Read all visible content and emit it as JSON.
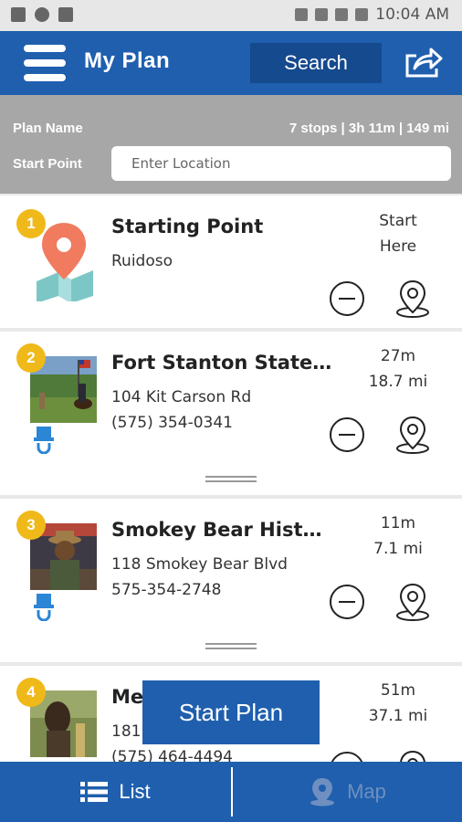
{
  "status_bar": {
    "time": "10:04 AM"
  },
  "header": {
    "title": "My Plan",
    "search_label": "Search"
  },
  "plan": {
    "name_label": "Plan Name",
    "stats": "7 stops | 3h 11m | 149 mi",
    "start_point_label": "Start Point",
    "location_placeholder": "Enter Location"
  },
  "stops": [
    {
      "number": "1",
      "name": "Starting Point",
      "line1": "Ruidoso",
      "line2": "",
      "meta1": "Start",
      "meta2": "Here"
    },
    {
      "number": "2",
      "name": "Fort Stanton State…",
      "line1": "104 Kit Carson Rd",
      "line2": "(575) 354-0341",
      "meta1": "27m",
      "meta2": "18.7 mi"
    },
    {
      "number": "3",
      "name": "Smokey Bear Hist…",
      "line1": "118 Smokey Bear Blvd",
      "line2": "575-354-2748",
      "meta1": "11m",
      "meta2": "7.1 mi"
    },
    {
      "number": "4",
      "name": "Me",
      "line1": "181",
      "line2": "(575) 464-4494",
      "meta1": "51m",
      "meta2": "37.1 mi"
    }
  ],
  "start_plan_label": "Start Plan",
  "bottom_nav": {
    "list_label": "List",
    "map_label": "Map"
  },
  "colors": {
    "primary": "#1f5fae",
    "badge": "#f0b91a",
    "plan_bar": "#a7a7a7"
  }
}
